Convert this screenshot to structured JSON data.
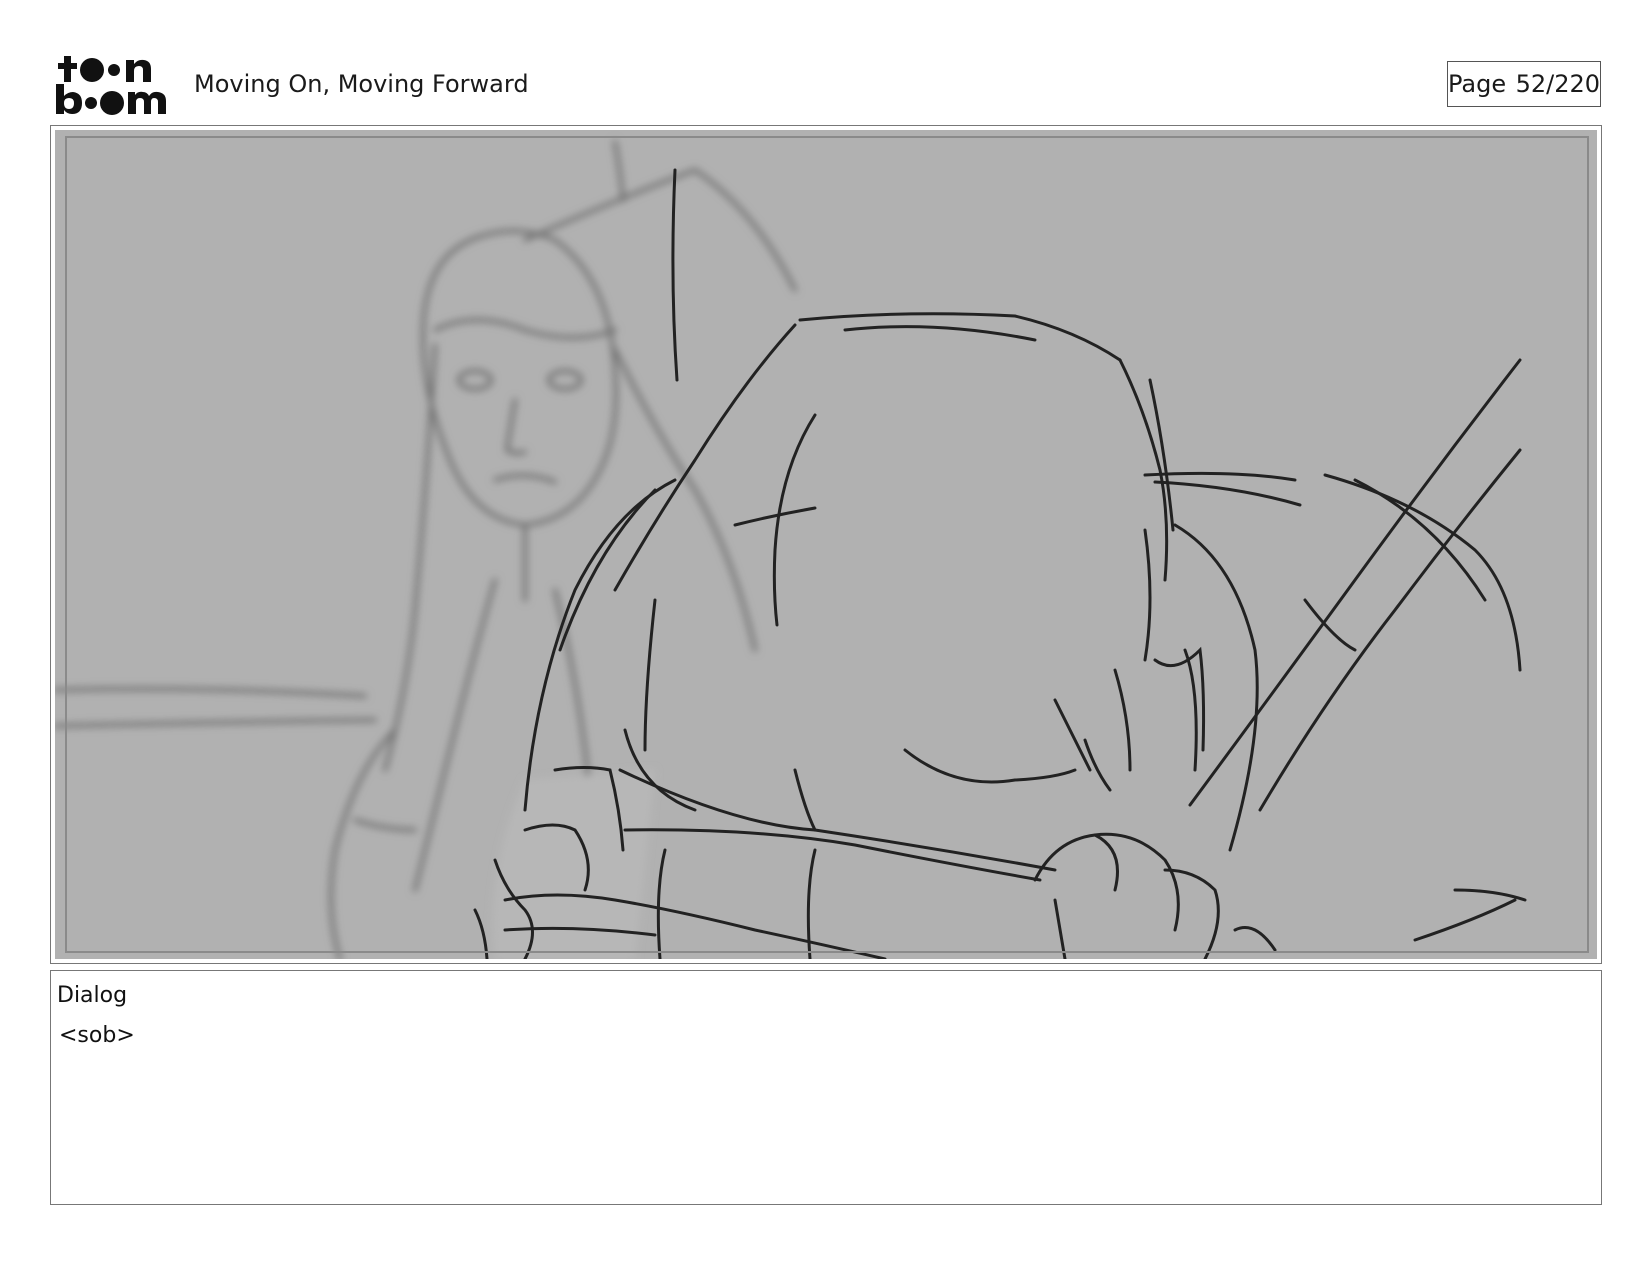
{
  "header": {
    "logo_text": "toon boom",
    "project_title": "Moving On, Moving Forward",
    "page_label": "Page",
    "page_number": "52/220"
  },
  "panel": {
    "image": "storyboard-sketch-panel",
    "background_color": "#b1b1b1"
  },
  "dialog": {
    "label": "Dialog",
    "text": "<sob>"
  }
}
